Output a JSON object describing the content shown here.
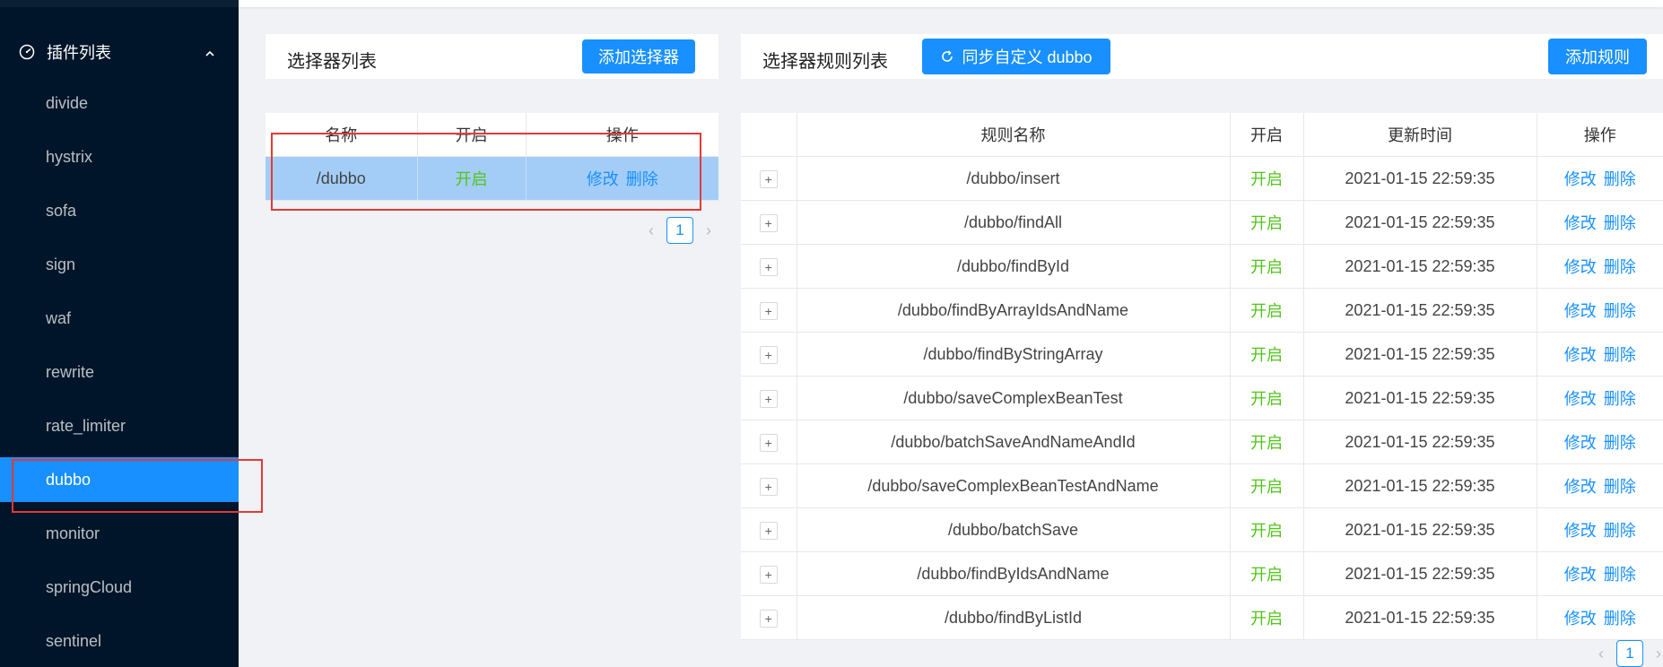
{
  "sidebar": {
    "submenu_title": "插件列表",
    "items": [
      {
        "label": "divide",
        "active": false
      },
      {
        "label": "hystrix",
        "active": false
      },
      {
        "label": "sofa",
        "active": false
      },
      {
        "label": "sign",
        "active": false
      },
      {
        "label": "waf",
        "active": false
      },
      {
        "label": "rewrite",
        "active": false
      },
      {
        "label": "rate_limiter",
        "active": false
      },
      {
        "label": "dubbo",
        "active": true
      },
      {
        "label": "monitor",
        "active": false
      },
      {
        "label": "springCloud",
        "active": false
      },
      {
        "label": "sentinel",
        "active": false
      }
    ]
  },
  "selector_panel": {
    "title": "选择器列表",
    "add_button": "添加选择器",
    "columns": [
      "名称",
      "开启",
      "操作"
    ],
    "rows": [
      {
        "name": "/dubbo",
        "status": "开启",
        "edit": "修改",
        "delete": "删除"
      }
    ],
    "pagination": {
      "current": "1"
    }
  },
  "rule_panel": {
    "title": "选择器规则列表",
    "sync_button": "同步自定义 dubbo",
    "add_button": "添加规则",
    "columns": [
      "",
      "规则名称",
      "开启",
      "更新时间",
      "操作"
    ],
    "rows": [
      {
        "name": "/dubbo/insert",
        "status": "开启",
        "time": "2021-01-15 22:59:35",
        "edit": "修改",
        "delete": "删除"
      },
      {
        "name": "/dubbo/findAll",
        "status": "开启",
        "time": "2021-01-15 22:59:35",
        "edit": "修改",
        "delete": "删除"
      },
      {
        "name": "/dubbo/findById",
        "status": "开启",
        "time": "2021-01-15 22:59:35",
        "edit": "修改",
        "delete": "删除"
      },
      {
        "name": "/dubbo/findByArrayIdsAndName",
        "status": "开启",
        "time": "2021-01-15 22:59:35",
        "edit": "修改",
        "delete": "删除"
      },
      {
        "name": "/dubbo/findByStringArray",
        "status": "开启",
        "time": "2021-01-15 22:59:35",
        "edit": "修改",
        "delete": "删除"
      },
      {
        "name": "/dubbo/saveComplexBeanTest",
        "status": "开启",
        "time": "2021-01-15 22:59:35",
        "edit": "修改",
        "delete": "删除"
      },
      {
        "name": "/dubbo/batchSaveAndNameAndId",
        "status": "开启",
        "time": "2021-01-15 22:59:35",
        "edit": "修改",
        "delete": "删除"
      },
      {
        "name": "/dubbo/saveComplexBeanTestAndName",
        "status": "开启",
        "time": "2021-01-15 22:59:35",
        "edit": "修改",
        "delete": "删除"
      },
      {
        "name": "/dubbo/batchSave",
        "status": "开启",
        "time": "2021-01-15 22:59:35",
        "edit": "修改",
        "delete": "删除"
      },
      {
        "name": "/dubbo/findByIdsAndName",
        "status": "开启",
        "time": "2021-01-15 22:59:35",
        "edit": "修改",
        "delete": "删除"
      },
      {
        "name": "/dubbo/findByListId",
        "status": "开启",
        "time": "2021-01-15 22:59:35",
        "edit": "修改",
        "delete": "删除"
      }
    ],
    "pagination": {
      "current": "1"
    }
  },
  "icons": {
    "submenu": "dashboard-icon",
    "submenu_arrow": "chevron-up-icon",
    "sync": "refresh-icon",
    "expand": "plus-icon",
    "prev": "chevron-left-icon",
    "next": "chevron-right-icon"
  },
  "colors": {
    "sidebar_bg": "#001529",
    "primary": "#1890ff",
    "enabled": "#52c41a",
    "selected_row": "#a3cdf7",
    "highlight": "#e53935"
  }
}
